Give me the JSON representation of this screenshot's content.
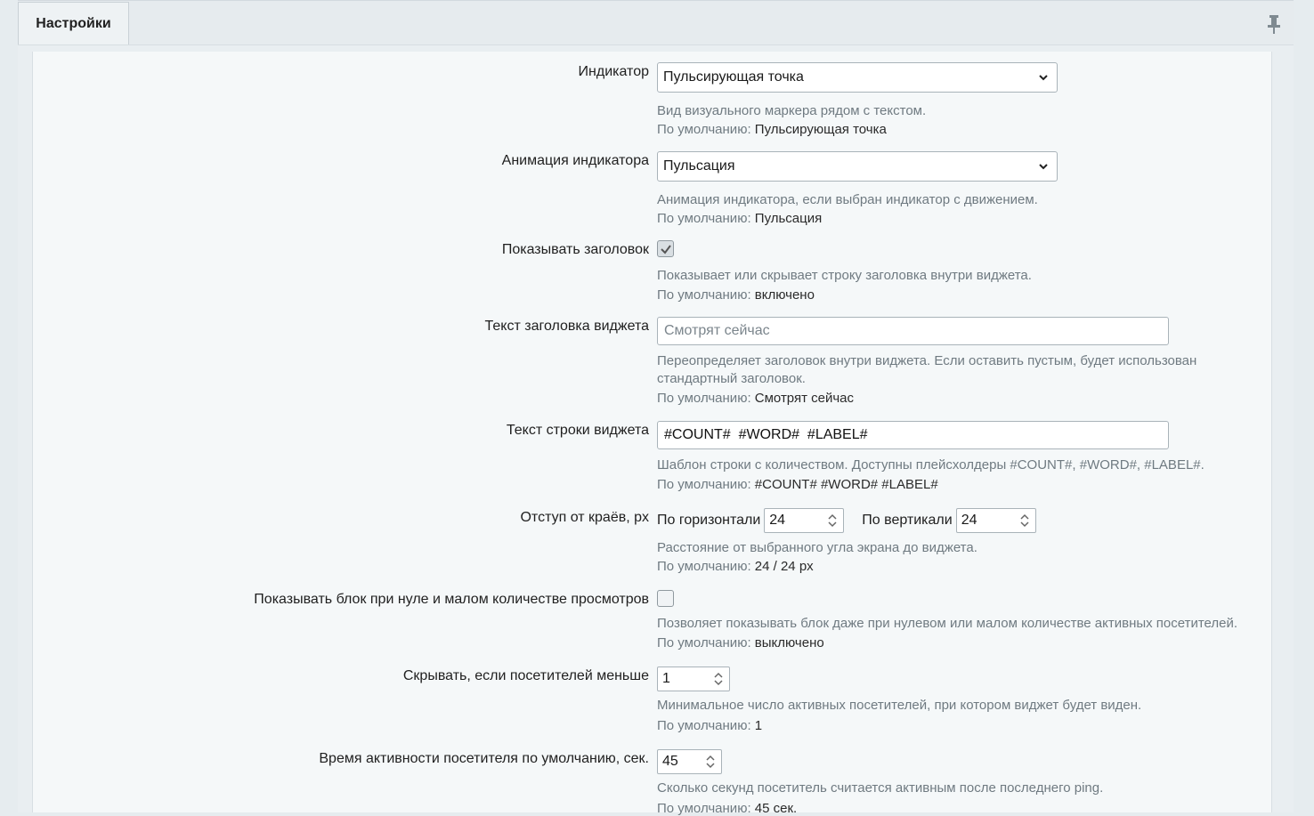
{
  "tab": {
    "label": "Настройки"
  },
  "default_prefix": "По умолчанию:",
  "indicator": {
    "label": "Индикатор",
    "value": "Пульсирующая точка",
    "hint": "Вид визуального маркера рядом с текстом.",
    "default": "Пульсирующая точка"
  },
  "animation": {
    "label": "Анимация индикатора",
    "value": "Пульсация",
    "hint": "Анимация индикатора, если выбран индикатор с движением.",
    "default": "Пульсация"
  },
  "show_header": {
    "label": "Показывать заголовок",
    "checked": true,
    "hint": "Показывает или скрывает строку заголовка внутри виджета.",
    "default": "включено"
  },
  "header_text": {
    "label": "Текст заголовка виджета",
    "placeholder": "Смотрят сейчас",
    "hint_line1": "Переопределяет заголовок внутри виджета. Если оставить пустым, будет использован",
    "hint_line2": "стандартный заголовок.",
    "default": "Смотрят сейчас"
  },
  "row_text": {
    "label": "Текст строки виджета",
    "value": "#COUNT#  #WORD#  #LABEL#",
    "hint": "Шаблон строки с количеством. Доступны плейсхолдеры #COUNT#, #WORD#, #LABEL#.",
    "default": "#COUNT# #WORD# #LABEL#"
  },
  "offset": {
    "label": "Отступ от краёв, px",
    "horizontal_label": "По горизонтали",
    "horizontal_value": "24",
    "vertical_label": "По вертикали",
    "vertical_value": "24",
    "hint": "Расстояние от выбранного угла экрана до виджета.",
    "default": "24 / 24 px"
  },
  "show_zero": {
    "label": "Показывать блок при нуле и малом количестве просмотров",
    "checked": false,
    "hint": "Позволяет показывать блок даже при нулевом или малом количестве активных посетителей.",
    "default": "выключено"
  },
  "hide_less": {
    "label": "Скрывать, если посетителей меньше",
    "value": "1",
    "hint": "Минимальное число активных посетителей, при котором виджет будет виден.",
    "default": "1"
  },
  "activity_time": {
    "label": "Время активности посетителя по умолчанию, сек.",
    "value": "45",
    "hint": "Сколько секунд посетитель считается активным после последнего ping.",
    "default": "45 сек."
  }
}
